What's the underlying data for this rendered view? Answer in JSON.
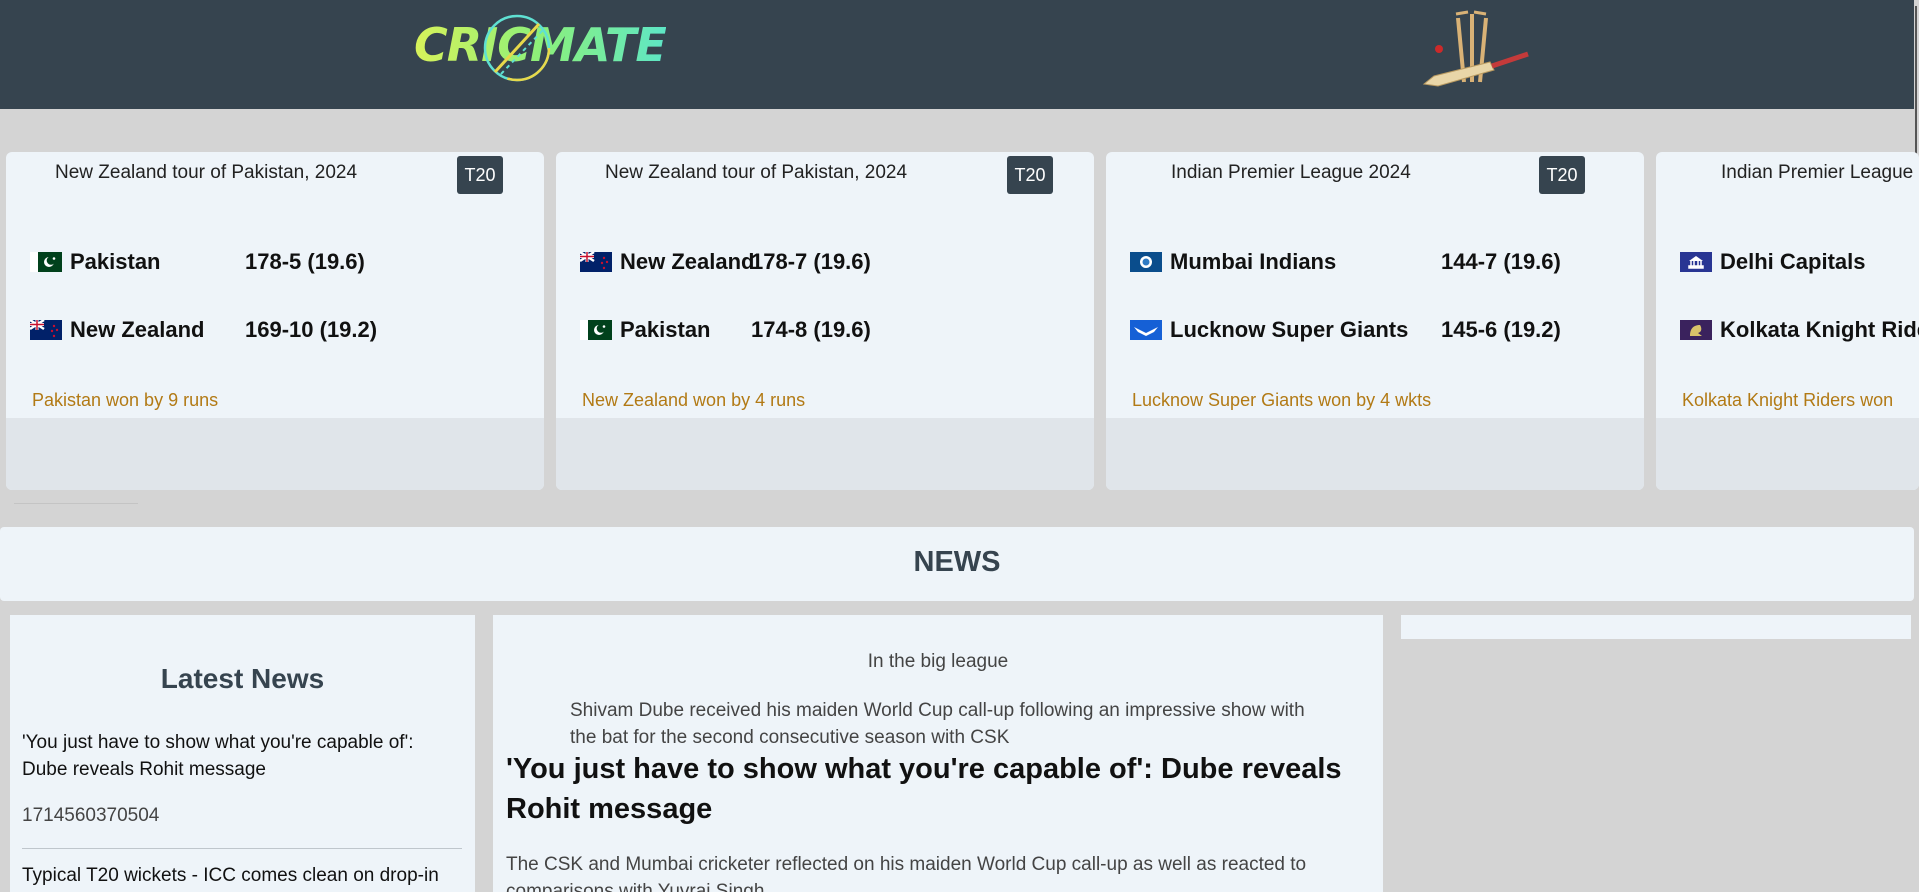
{
  "header": {
    "logo_text": "CRICMATE",
    "logo_icon": "cricket-ball-icon",
    "decor_icon": "stumps-bat-icon"
  },
  "matches": [
    {
      "series": "New Zealand tour of Pakistan, 2024",
      "format": "T20",
      "teams": [
        {
          "name": "Pakistan",
          "score": "178-5 (19.6)",
          "flag": "pakistan-flag-icon"
        },
        {
          "name": "New Zealand",
          "score": "169-10 (19.2)",
          "flag": "new-zealand-flag-icon"
        }
      ],
      "result": "Pakistan won by 9 runs"
    },
    {
      "series": "New Zealand tour of Pakistan, 2024",
      "format": "T20",
      "teams": [
        {
          "name": "New Zealand",
          "score": "178-7 (19.6)",
          "flag": "new-zealand-flag-icon"
        },
        {
          "name": "Pakistan",
          "score": "174-8 (19.6)",
          "flag": "pakistan-flag-icon"
        }
      ],
      "result": "New Zealand won by 4 runs"
    },
    {
      "series": "Indian Premier League 2024",
      "format": "T20",
      "teams": [
        {
          "name": "Mumbai Indians",
          "score": "144-7 (19.6)",
          "flag": "mumbai-indians-logo-icon"
        },
        {
          "name": "Lucknow Super Giants",
          "score": "145-6 (19.2)",
          "flag": "lucknow-super-giants-logo-icon"
        }
      ],
      "result": "Lucknow Super Giants won by 4 wkts"
    },
    {
      "series": "Indian Premier League",
      "teams": [
        {
          "name": "Delhi Capitals",
          "flag": "delhi-capitals-logo-icon"
        },
        {
          "name": "Kolkata Knight Ride",
          "flag": "kolkata-knight-riders-logo-icon"
        }
      ],
      "result": "Kolkata Knight Riders won"
    }
  ],
  "news": {
    "section_title": "NEWS",
    "latest": {
      "heading": "Latest News",
      "items": [
        {
          "title": "'You just have to show what you're capable of': Dube reveals Rohit message",
          "time": "1714560370504"
        },
        {
          "title": "Typical T20 wickets - ICC comes clean on drop-in"
        }
      ]
    },
    "article": {
      "kicker": "In the big league",
      "summary": "Shivam Dube received his maiden World Cup call-up following an impressive show with the bat for the second consecutive season with CSK",
      "headline": "'You just have to show what you're capable of': Dube reveals Rohit message",
      "body": "The CSK and Mumbai cricketer reflected on his maiden World Cup call-up as well as reacted to comparisons with Yuvraj Singh"
    }
  },
  "colors": {
    "header_bg": "#36444f",
    "page_bg": "#d4d4d4",
    "card_bg": "#eef4f9",
    "result_text": "#b27a15",
    "badge_bg": "#36444f"
  }
}
